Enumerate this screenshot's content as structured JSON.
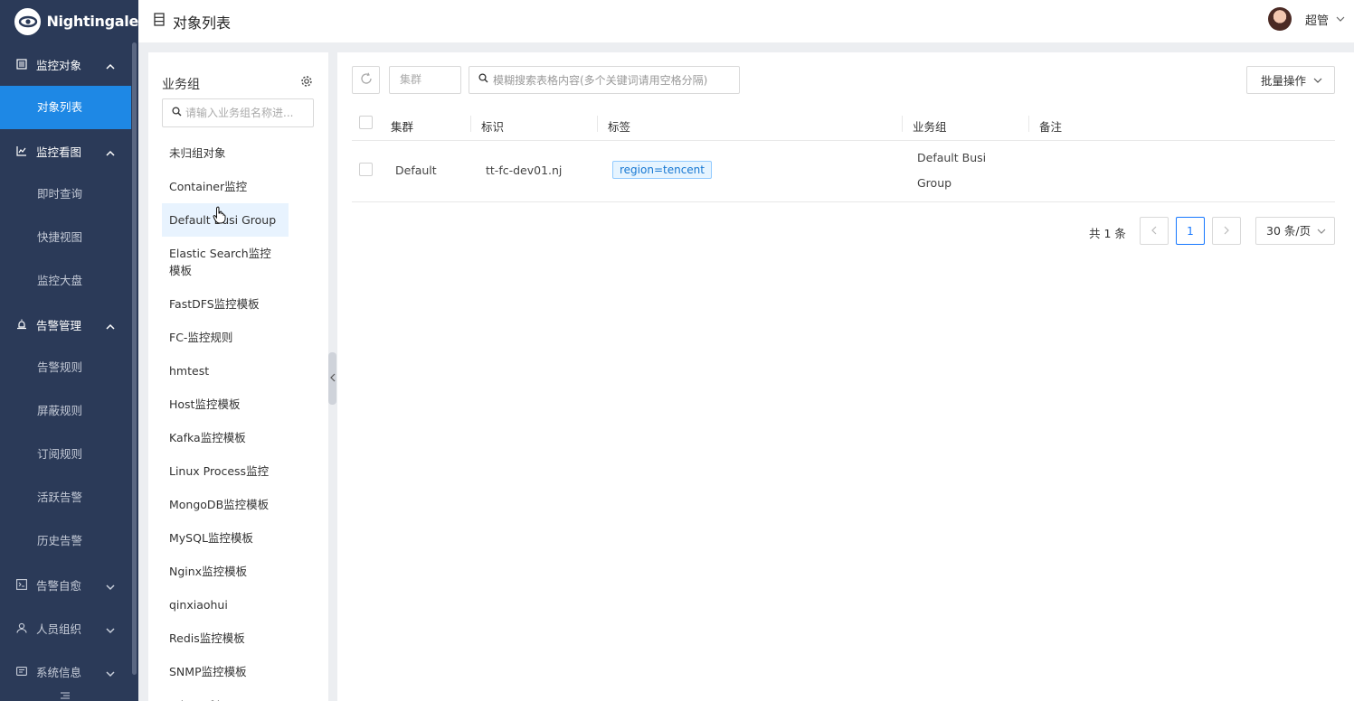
{
  "app": {
    "brand": "Nightingale"
  },
  "header": {
    "title": "对象列表",
    "user_name": "超管"
  },
  "sidebar": {
    "groups": [
      {
        "label": "监控对象",
        "icon": "list-icon",
        "expanded": true,
        "items": [
          {
            "label": "对象列表",
            "active": true
          }
        ]
      },
      {
        "label": "监控看图",
        "icon": "line-chart-icon",
        "expanded": true,
        "items": [
          {
            "label": "即时查询"
          },
          {
            "label": "快捷视图"
          },
          {
            "label": "监控大盘"
          }
        ]
      },
      {
        "label": "告警管理",
        "icon": "alarm-icon",
        "expanded": true,
        "items": [
          {
            "label": "告警规则"
          },
          {
            "label": "屏蔽规则"
          },
          {
            "label": "订阅规则"
          },
          {
            "label": "活跃告警"
          },
          {
            "label": "历史告警"
          }
        ]
      },
      {
        "label": "告警自愈",
        "icon": "terminal-icon",
        "expanded": false,
        "items": []
      },
      {
        "label": "人员组织",
        "icon": "user-icon",
        "expanded": false,
        "items": []
      },
      {
        "label": "系统信息",
        "icon": "info-icon",
        "expanded": false,
        "items": []
      }
    ]
  },
  "busi_groups": {
    "title": "业务组",
    "search_placeholder": "请输入业务组名称进...",
    "items": [
      "未归组对象",
      "Container监控",
      "Default Busi Group",
      "Elastic Search监控模板",
      "FastDFS监控模板",
      "FC-监控规则",
      "hmtest",
      "Host监控模板",
      "Kafka监控模板",
      "Linux Process监控",
      "MongoDB监控模板",
      "MySQL监控模板",
      "Nginx监控模板",
      "qinxiaohui",
      "Redis监控模板",
      "SNMP监控模板",
      "telegraf-host"
    ],
    "selected_index": 2
  },
  "toolbar": {
    "cluster_placeholder": "集群",
    "search_placeholder": "模糊搜索表格内容(多个关键词请用空格分隔)",
    "batch_label": "批量操作"
  },
  "table": {
    "columns": [
      "集群",
      "标识",
      "标签",
      "业务组",
      "备注"
    ],
    "rows": [
      {
        "cluster": "Default",
        "ident": "tt-fc-dev01.nj",
        "tag": "region=tencent",
        "group_line1": "Default Busi",
        "group_line2": "Group",
        "note": ""
      }
    ]
  },
  "pagination": {
    "total_text": "共 1 条",
    "current_page": "1",
    "page_size": "30 条/页"
  },
  "colors": {
    "sidebar_bg": "#2b3a58",
    "accent": "#1e88e5",
    "selected_bg": "#e8f3fe"
  }
}
